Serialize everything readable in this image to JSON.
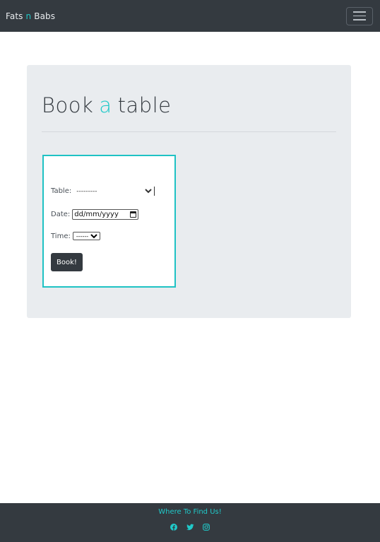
{
  "navbar": {
    "brand_part1": "Fats",
    "brand_accent": "n",
    "brand_part2": "Babs",
    "toggle_icon": "hamburger-icon"
  },
  "page": {
    "heading_part1": "Book",
    "heading_accent": "a",
    "heading_part2": "table"
  },
  "form": {
    "table_label": "Table:",
    "table_value": "---------",
    "date_label": "Date:",
    "date_placeholder": "dd/mm/yyyy",
    "time_label": "Time:",
    "time_value": "---------",
    "submit_label": "Book!"
  },
  "footer": {
    "title": "Where To Find Us!",
    "icons": [
      "facebook-icon",
      "twitter-icon",
      "instagram-icon"
    ]
  },
  "colors": {
    "accent": "#20c9c9",
    "dark": "#343a40",
    "jumbotron_bg": "#e9ecef"
  }
}
